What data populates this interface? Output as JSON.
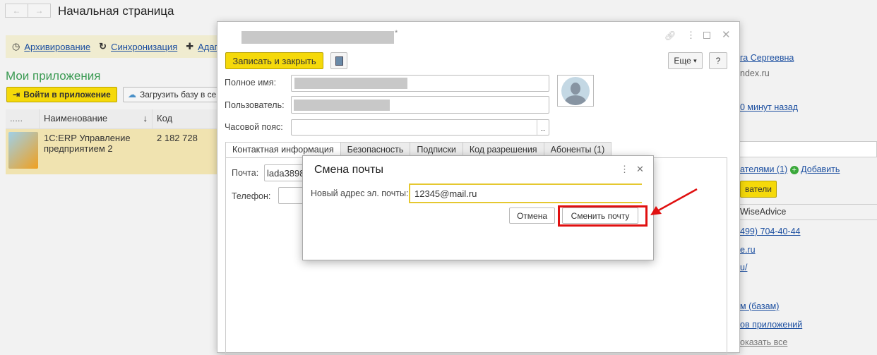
{
  "header": {
    "back": "←",
    "forward": "→",
    "title": "Начальная страница"
  },
  "linkbar": {
    "items": [
      {
        "icon": "clock-icon",
        "label": "Архивирование"
      },
      {
        "icon": "refresh-icon",
        "label": "Синхронизация"
      },
      {
        "icon": "puzzle-icon",
        "label": "Адаптация"
      }
    ]
  },
  "apps": {
    "title": "Мои приложения",
    "enter_button": "Войти в приложение",
    "upload_button": "Загрузить базу в сервис",
    "columns": [
      ".....",
      "Наименование",
      "↓",
      "Код"
    ],
    "rows": [
      {
        "name": "1С:ERP Управление предприятием 2",
        "code": "2 182 728"
      }
    ]
  },
  "form": {
    "title_suffix": "*",
    "save_close": "Записать и закрыть",
    "more": "Еще",
    "more_arrow": "▾",
    "help": "?",
    "fields": {
      "full_name": "Полное имя:",
      "user": "Пользователь:",
      "timezone": "Часовой пояс:",
      "timezone_btn": "..."
    },
    "tabs": [
      "Контактная информация",
      "Безопасность",
      "Подписки",
      "Код разрешения",
      "Абоненты (1)"
    ],
    "email_label": "Почта:",
    "email_value": "lada3898",
    "phone_label": "Телефон:"
  },
  "dialog": {
    "title": "Смена почты",
    "field_label": "Новый адрес эл. почты:",
    "field_value": "12345@mail.ru",
    "cancel": "Отмена",
    "confirm": "Сменить почту"
  },
  "right": {
    "name": "га Сергеевна",
    "email": "ndex.ru",
    "time": "0 минут назад",
    "users_link": "ателями (1)",
    "add": "Добавить",
    "users_btn": "ватели",
    "company": "WiseAdvice",
    "phone": "499) 704-40-44",
    "site1": "e.ru",
    "site2": "u/",
    "bases": "м (базам)",
    "apps": "ов приложений",
    "show_all": "оказать все"
  }
}
